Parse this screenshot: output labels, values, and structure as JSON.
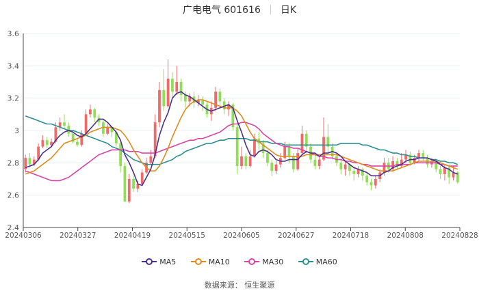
{
  "title": {
    "name": "广电电气 601616",
    "period": "日K"
  },
  "source": "数据来源：  恒生聚源",
  "colors": {
    "up": "#f06a6a",
    "down": "#91dd55",
    "ma5": "#4b2f8c",
    "ma10": "#e08a1e",
    "ma30": "#d944a6",
    "ma60": "#2b8f8f",
    "grid": "#e8ecf2",
    "axis": "#444444"
  },
  "chart_data": {
    "type": "candlestick",
    "ylim": [
      2.4,
      3.6
    ],
    "yticks": [
      2.4,
      2.6,
      2.8,
      3,
      3.2,
      3.4,
      3.6
    ],
    "xticks": [
      "20240306",
      "20240327",
      "20240419",
      "20240515",
      "20240605",
      "20240627",
      "20240718",
      "20240808",
      "20240828"
    ],
    "legend": [
      "MA5",
      "MA10",
      "MA30",
      "MA60"
    ],
    "candles": [
      {
        "o": 2.76,
        "c": 2.83,
        "h": 2.85,
        "l": 2.74
      },
      {
        "o": 2.83,
        "c": 2.79,
        "h": 2.86,
        "l": 2.77
      },
      {
        "o": 2.79,
        "c": 2.82,
        "h": 2.84,
        "l": 2.78
      },
      {
        "o": 2.82,
        "c": 2.9,
        "h": 2.92,
        "l": 2.81
      },
      {
        "o": 2.9,
        "c": 2.94,
        "h": 2.97,
        "l": 2.89
      },
      {
        "o": 2.94,
        "c": 2.91,
        "h": 2.96,
        "l": 2.89
      },
      {
        "o": 2.91,
        "c": 2.93,
        "h": 2.95,
        "l": 2.9
      },
      {
        "o": 2.93,
        "c": 3.02,
        "h": 3.05,
        "l": 2.92
      },
      {
        "o": 3.02,
        "c": 3.05,
        "h": 3.08,
        "l": 3.0
      },
      {
        "o": 3.05,
        "c": 3.03,
        "h": 3.1,
        "l": 3.01
      },
      {
        "o": 3.03,
        "c": 2.98,
        "h": 3.05,
        "l": 2.96
      },
      {
        "o": 2.98,
        "c": 2.93,
        "h": 3.0,
        "l": 2.92
      },
      {
        "o": 2.93,
        "c": 2.91,
        "h": 2.95,
        "l": 2.9
      },
      {
        "o": 2.91,
        "c": 2.98,
        "h": 3.0,
        "l": 2.9
      },
      {
        "o": 2.98,
        "c": 3.1,
        "h": 3.13,
        "l": 2.97
      },
      {
        "o": 3.1,
        "c": 3.13,
        "h": 3.16,
        "l": 3.08
      },
      {
        "o": 3.13,
        "c": 3.08,
        "h": 3.14,
        "l": 3.05
      },
      {
        "o": 3.08,
        "c": 3.05,
        "h": 3.1,
        "l": 3.03
      },
      {
        "o": 3.05,
        "c": 2.98,
        "h": 3.07,
        "l": 2.96
      },
      {
        "o": 2.98,
        "c": 3.02,
        "h": 3.04,
        "l": 2.97
      },
      {
        "o": 3.02,
        "c": 2.99,
        "h": 3.03,
        "l": 2.96
      },
      {
        "o": 2.99,
        "c": 2.92,
        "h": 3.0,
        "l": 2.9
      },
      {
        "o": 2.92,
        "c": 2.78,
        "h": 2.94,
        "l": 2.74
      },
      {
        "o": 2.78,
        "c": 2.56,
        "h": 2.8,
        "l": 2.56
      },
      {
        "o": 2.56,
        "c": 2.7,
        "h": 2.73,
        "l": 2.55
      },
      {
        "o": 2.7,
        "c": 2.64,
        "h": 2.72,
        "l": 2.62
      },
      {
        "o": 2.64,
        "c": 2.67,
        "h": 2.69,
        "l": 2.62
      },
      {
        "o": 2.67,
        "c": 2.74,
        "h": 2.76,
        "l": 2.66
      },
      {
        "o": 2.74,
        "c": 2.8,
        "h": 2.83,
        "l": 2.73
      },
      {
        "o": 2.8,
        "c": 2.84,
        "h": 2.88,
        "l": 2.79
      },
      {
        "o": 2.84,
        "c": 3.05,
        "h": 3.1,
        "l": 2.83
      },
      {
        "o": 3.05,
        "c": 3.25,
        "h": 3.3,
        "l": 3.02
      },
      {
        "o": 3.25,
        "c": 3.15,
        "h": 3.38,
        "l": 3.12
      },
      {
        "o": 3.15,
        "c": 3.32,
        "h": 3.44,
        "l": 3.14
      },
      {
        "o": 3.32,
        "c": 3.24,
        "h": 3.36,
        "l": 3.2
      },
      {
        "o": 3.24,
        "c": 3.3,
        "h": 3.4,
        "l": 3.22
      },
      {
        "o": 3.3,
        "c": 3.22,
        "h": 3.32,
        "l": 3.18
      },
      {
        "o": 3.22,
        "c": 3.18,
        "h": 3.24,
        "l": 3.14
      },
      {
        "o": 3.18,
        "c": 3.21,
        "h": 3.23,
        "l": 3.15
      },
      {
        "o": 3.21,
        "c": 3.17,
        "h": 3.24,
        "l": 3.14
      },
      {
        "o": 3.17,
        "c": 3.19,
        "h": 3.22,
        "l": 3.15
      },
      {
        "o": 3.19,
        "c": 3.16,
        "h": 3.21,
        "l": 3.12
      },
      {
        "o": 3.16,
        "c": 3.1,
        "h": 3.18,
        "l": 3.08
      },
      {
        "o": 3.1,
        "c": 3.14,
        "h": 3.18,
        "l": 3.06
      },
      {
        "o": 3.14,
        "c": 3.24,
        "h": 3.27,
        "l": 3.12
      },
      {
        "o": 3.24,
        "c": 3.18,
        "h": 3.26,
        "l": 3.15
      },
      {
        "o": 3.18,
        "c": 3.13,
        "h": 3.2,
        "l": 3.1
      },
      {
        "o": 3.13,
        "c": 3.16,
        "h": 3.18,
        "l": 3.09
      },
      {
        "o": 3.16,
        "c": 3.02,
        "h": 3.17,
        "l": 3.0
      },
      {
        "o": 3.02,
        "c": 2.78,
        "h": 3.04,
        "l": 2.73
      },
      {
        "o": 2.78,
        "c": 2.84,
        "h": 2.9,
        "l": 2.76
      },
      {
        "o": 2.84,
        "c": 2.78,
        "h": 2.86,
        "l": 2.76
      },
      {
        "o": 2.78,
        "c": 2.84,
        "h": 2.88,
        "l": 2.77
      },
      {
        "o": 2.84,
        "c": 2.95,
        "h": 2.98,
        "l": 2.83
      },
      {
        "o": 2.95,
        "c": 2.92,
        "h": 2.99,
        "l": 2.88
      },
      {
        "o": 2.92,
        "c": 2.86,
        "h": 2.94,
        "l": 2.83
      },
      {
        "o": 2.86,
        "c": 2.8,
        "h": 2.88,
        "l": 2.78
      },
      {
        "o": 2.8,
        "c": 2.75,
        "h": 2.82,
        "l": 2.72
      },
      {
        "o": 2.75,
        "c": 2.79,
        "h": 2.81,
        "l": 2.73
      },
      {
        "o": 2.79,
        "c": 2.83,
        "h": 2.86,
        "l": 2.77
      },
      {
        "o": 2.83,
        "c": 2.9,
        "h": 2.93,
        "l": 2.82
      },
      {
        "o": 2.9,
        "c": 2.84,
        "h": 2.92,
        "l": 2.8
      },
      {
        "o": 2.84,
        "c": 2.76,
        "h": 2.86,
        "l": 2.74
      },
      {
        "o": 2.76,
        "c": 2.86,
        "h": 2.89,
        "l": 2.75
      },
      {
        "o": 2.86,
        "c": 2.98,
        "h": 3.03,
        "l": 2.85
      },
      {
        "o": 2.98,
        "c": 2.9,
        "h": 3.0,
        "l": 2.86
      },
      {
        "o": 2.9,
        "c": 2.82,
        "h": 2.92,
        "l": 2.8
      },
      {
        "o": 2.82,
        "c": 2.78,
        "h": 2.85,
        "l": 2.76
      },
      {
        "o": 2.78,
        "c": 2.82,
        "h": 2.84,
        "l": 2.76
      },
      {
        "o": 2.82,
        "c": 2.96,
        "h": 3.08,
        "l": 2.81
      },
      {
        "o": 2.96,
        "c": 2.9,
        "h": 3.04,
        "l": 2.86
      },
      {
        "o": 2.9,
        "c": 2.84,
        "h": 2.92,
        "l": 2.82
      },
      {
        "o": 2.84,
        "c": 2.8,
        "h": 2.86,
        "l": 2.78
      },
      {
        "o": 2.8,
        "c": 2.76,
        "h": 2.82,
        "l": 2.73
      },
      {
        "o": 2.76,
        "c": 2.79,
        "h": 2.81,
        "l": 2.72
      },
      {
        "o": 2.79,
        "c": 2.75,
        "h": 2.8,
        "l": 2.72
      },
      {
        "o": 2.75,
        "c": 2.73,
        "h": 2.77,
        "l": 2.69
      },
      {
        "o": 2.73,
        "c": 2.76,
        "h": 2.78,
        "l": 2.71
      },
      {
        "o": 2.76,
        "c": 2.72,
        "h": 2.77,
        "l": 2.69
      },
      {
        "o": 2.72,
        "c": 2.68,
        "h": 2.74,
        "l": 2.66
      },
      {
        "o": 2.68,
        "c": 2.66,
        "h": 2.7,
        "l": 2.63
      },
      {
        "o": 2.66,
        "c": 2.7,
        "h": 2.72,
        "l": 2.64
      },
      {
        "o": 2.7,
        "c": 2.74,
        "h": 2.76,
        "l": 2.68
      },
      {
        "o": 2.74,
        "c": 2.8,
        "h": 2.83,
        "l": 2.72
      },
      {
        "o": 2.8,
        "c": 2.76,
        "h": 2.83,
        "l": 2.74
      },
      {
        "o": 2.76,
        "c": 2.81,
        "h": 2.84,
        "l": 2.75
      },
      {
        "o": 2.81,
        "c": 2.78,
        "h": 2.83,
        "l": 2.76
      },
      {
        "o": 2.78,
        "c": 2.82,
        "h": 2.86,
        "l": 2.77
      },
      {
        "o": 2.82,
        "c": 2.85,
        "h": 2.88,
        "l": 2.8
      },
      {
        "o": 2.85,
        "c": 2.8,
        "h": 2.87,
        "l": 2.78
      },
      {
        "o": 2.8,
        "c": 2.83,
        "h": 2.85,
        "l": 2.79
      },
      {
        "o": 2.83,
        "c": 2.86,
        "h": 2.88,
        "l": 2.81
      },
      {
        "o": 2.86,
        "c": 2.83,
        "h": 2.88,
        "l": 2.81
      },
      {
        "o": 2.83,
        "c": 2.79,
        "h": 2.85,
        "l": 2.77
      },
      {
        "o": 2.79,
        "c": 2.81,
        "h": 2.83,
        "l": 2.77
      },
      {
        "o": 2.81,
        "c": 2.76,
        "h": 2.82,
        "l": 2.74
      },
      {
        "o": 2.76,
        "c": 2.73,
        "h": 2.78,
        "l": 2.7
      },
      {
        "o": 2.73,
        "c": 2.77,
        "h": 2.79,
        "l": 2.69
      },
      {
        "o": 2.77,
        "c": 2.71,
        "h": 2.79,
        "l": 2.67
      },
      {
        "o": 2.71,
        "c": 2.74,
        "h": 2.78,
        "l": 2.69
      },
      {
        "o": 2.74,
        "c": 2.68,
        "h": 2.75,
        "l": 2.67
      }
    ],
    "ma5": [
      2.77,
      2.78,
      2.79,
      2.82,
      2.86,
      2.88,
      2.9,
      2.94,
      2.97,
      2.99,
      3.0,
      2.99,
      2.97,
      2.96,
      2.98,
      3.01,
      3.04,
      3.07,
      3.07,
      3.05,
      3.02,
      2.99,
      2.94,
      2.85,
      2.8,
      2.74,
      2.67,
      2.66,
      2.71,
      2.76,
      2.85,
      2.97,
      3.05,
      3.11,
      3.2,
      3.23,
      3.24,
      3.22,
      3.21,
      3.19,
      3.17,
      3.15,
      3.13,
      3.12,
      3.13,
      3.14,
      3.15,
      3.16,
      3.14,
      3.06,
      2.99,
      2.91,
      2.85,
      2.84,
      2.87,
      2.88,
      2.87,
      2.85,
      2.82,
      2.81,
      2.81,
      2.82,
      2.82,
      2.82,
      2.85,
      2.87,
      2.86,
      2.86,
      2.84,
      2.86,
      2.86,
      2.87,
      2.86,
      2.84,
      2.81,
      2.79,
      2.77,
      2.76,
      2.75,
      2.74,
      2.72,
      2.72,
      2.72,
      2.74,
      2.75,
      2.77,
      2.78,
      2.79,
      2.81,
      2.82,
      2.82,
      2.83,
      2.83,
      2.83,
      2.82,
      2.81,
      2.79,
      2.77,
      2.76,
      2.74,
      2.73
    ],
    "ma10": [
      2.73,
      2.74,
      2.75,
      2.77,
      2.79,
      2.81,
      2.83,
      2.86,
      2.89,
      2.92,
      2.93,
      2.94,
      2.95,
      2.96,
      2.97,
      2.99,
      3.0,
      3.01,
      3.02,
      3.02,
      3.02,
      3.01,
      3.0,
      2.97,
      2.93,
      2.88,
      2.84,
      2.8,
      2.77,
      2.75,
      2.75,
      2.78,
      2.83,
      2.89,
      2.96,
      3.02,
      3.08,
      3.13,
      3.16,
      3.18,
      3.19,
      3.19,
      3.18,
      3.17,
      3.16,
      3.15,
      3.14,
      3.14,
      3.14,
      3.12,
      3.09,
      3.04,
      2.99,
      2.95,
      2.93,
      2.91,
      2.89,
      2.87,
      2.85,
      2.84,
      2.84,
      2.84,
      2.84,
      2.84,
      2.84,
      2.85,
      2.85,
      2.85,
      2.85,
      2.85,
      2.85,
      2.85,
      2.85,
      2.84,
      2.83,
      2.82,
      2.81,
      2.8,
      2.79,
      2.78,
      2.77,
      2.76,
      2.75,
      2.75,
      2.75,
      2.75,
      2.76,
      2.77,
      2.78,
      2.79,
      2.8,
      2.81,
      2.81,
      2.81,
      2.81,
      2.81,
      2.8,
      2.79,
      2.78,
      2.77,
      2.76
    ],
    "ma30": [
      2.75,
      2.74,
      2.73,
      2.72,
      2.71,
      2.7,
      2.69,
      2.69,
      2.69,
      2.7,
      2.71,
      2.73,
      2.75,
      2.77,
      2.79,
      2.81,
      2.83,
      2.85,
      2.86,
      2.87,
      2.88,
      2.88,
      2.88,
      2.88,
      2.87,
      2.87,
      2.87,
      2.86,
      2.86,
      2.86,
      2.86,
      2.87,
      2.88,
      2.89,
      2.9,
      2.91,
      2.92,
      2.93,
      2.94,
      2.94,
      2.95,
      2.95,
      2.96,
      2.97,
      2.98,
      2.99,
      3.01,
      3.03,
      3.04,
      3.04,
      3.05,
      3.05,
      3.04,
      3.03,
      3.01,
      2.98,
      2.96,
      2.94,
      2.92,
      2.91,
      2.9,
      2.9,
      2.89,
      2.89,
      2.88,
      2.87,
      2.86,
      2.85,
      2.84,
      2.84,
      2.83,
      2.83,
      2.82,
      2.82,
      2.81,
      2.81,
      2.8,
      2.8,
      2.79,
      2.79,
      2.78,
      2.78,
      2.78,
      2.78,
      2.78,
      2.78,
      2.79,
      2.79,
      2.79,
      2.79,
      2.8,
      2.8,
      2.8,
      2.8,
      2.8,
      2.8,
      2.79,
      2.79,
      2.78,
      2.78,
      2.78
    ],
    "ma60": [
      3.09,
      3.08,
      3.07,
      3.06,
      3.05,
      3.04,
      3.04,
      3.03,
      3.02,
      3.01,
      3.0,
      3.0,
      2.99,
      2.98,
      2.97,
      2.96,
      2.95,
      2.94,
      2.93,
      2.92,
      2.9,
      2.89,
      2.88,
      2.86,
      2.84,
      2.82,
      2.81,
      2.8,
      2.79,
      2.79,
      2.79,
      2.79,
      2.8,
      2.81,
      2.82,
      2.84,
      2.85,
      2.87,
      2.88,
      2.89,
      2.9,
      2.91,
      2.92,
      2.92,
      2.93,
      2.94,
      2.94,
      2.95,
      2.95,
      2.95,
      2.95,
      2.95,
      2.94,
      2.94,
      2.93,
      2.93,
      2.93,
      2.92,
      2.92,
      2.92,
      2.91,
      2.91,
      2.91,
      2.91,
      2.91,
      2.91,
      2.91,
      2.91,
      2.91,
      2.91,
      2.91,
      2.91,
      2.91,
      2.92,
      2.92,
      2.92,
      2.92,
      2.92,
      2.91,
      2.91,
      2.9,
      2.89,
      2.88,
      2.88,
      2.87,
      2.86,
      2.86,
      2.85,
      2.85,
      2.84,
      2.84,
      2.83,
      2.83,
      2.83,
      2.82,
      2.82,
      2.81,
      2.81,
      2.8,
      2.8,
      2.79
    ]
  }
}
